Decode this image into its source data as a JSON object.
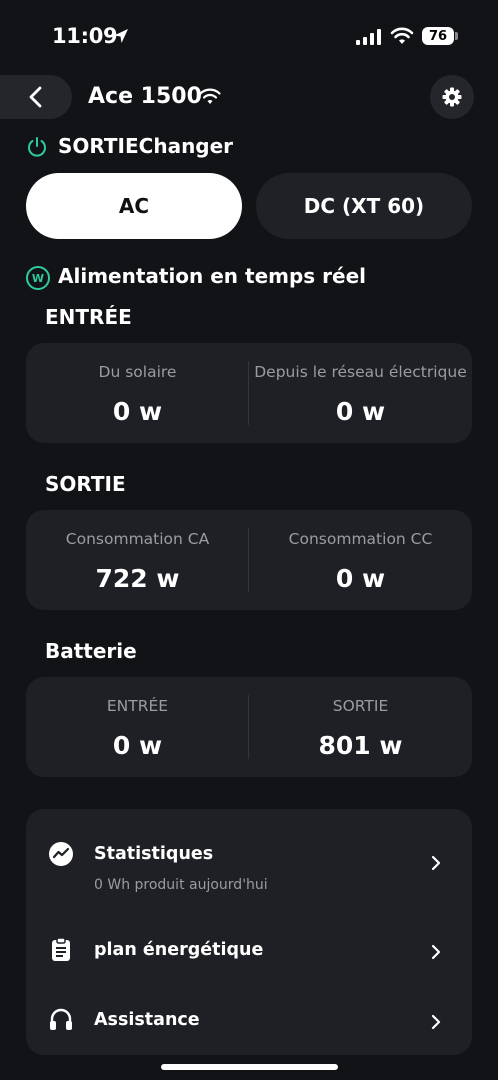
{
  "status_bar": {
    "time": "11:09",
    "battery": "76"
  },
  "header": {
    "device_name": "Ace 1500"
  },
  "output_row": {
    "label": "SORTIEChanger"
  },
  "segments": {
    "ac": "AC",
    "dc": "DC (XT 60)",
    "selected": "AC"
  },
  "realtime": {
    "title": "Alimentation en temps réel"
  },
  "input": {
    "title": "ENTRÉE",
    "left": {
      "label": "Du solaire",
      "value": "0 w"
    },
    "right": {
      "label": "Depuis le réseau électrique",
      "value": "0 w"
    }
  },
  "output": {
    "title": "SORTIE",
    "left": {
      "label": "Consommation CA",
      "value": "722 w"
    },
    "right": {
      "label": "Consommation CC",
      "value": "0 w"
    }
  },
  "battery_section": {
    "title": "Batterie",
    "left": {
      "label": "ENTRÉE",
      "value": "0 w"
    },
    "right": {
      "label": "SORTIE",
      "value": "801 w"
    }
  },
  "menu": {
    "statistics": {
      "label": "Statistiques",
      "sub": "0 Wh produit aujourd'hui"
    },
    "energy_plan": {
      "label": "plan énergétique"
    },
    "support": {
      "label": "Assistance"
    }
  },
  "colors": {
    "accent": "#2ecc9a",
    "background": "#121316",
    "card": "#1e2025"
  },
  "icons": [
    "location-arrow-icon",
    "signal-icon",
    "wifi-icon",
    "battery-icon",
    "chevron-left-icon",
    "gear-icon",
    "power-icon",
    "w-circle-icon",
    "trend-icon",
    "clipboard-icon",
    "headset-icon",
    "chevron-right-icon"
  ]
}
